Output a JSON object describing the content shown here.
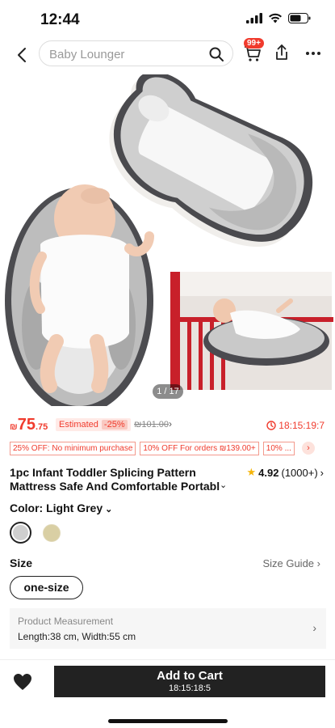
{
  "status": {
    "time": "12:44"
  },
  "header": {
    "search_placeholder": "Baby Lounger",
    "cart_badge": "99+",
    "icons": [
      "back-arrow-icon",
      "search-icon",
      "cart-icon",
      "share-icon",
      "more-icon"
    ]
  },
  "gallery": {
    "counter": "1 / 17"
  },
  "price": {
    "currency": "₪",
    "integer": "75",
    "decimal": ".75",
    "estimated_label": "Estimated",
    "discount": "-25%",
    "original": "₪101.00",
    "countdown": "18:15:19:7"
  },
  "coupons": [
    "25% OFF: No minimum purchase",
    "10% OFF For orders ₪139.00+",
    "10% ..."
  ],
  "product": {
    "title": "1pc Infant Toddler Splicing Pattern Mattress Safe And Comfortable Portabl",
    "rating": "4.92",
    "reviews": "(1000+)"
  },
  "color": {
    "label": "Color: Light Grey",
    "options": [
      "Light Grey",
      "Beige"
    ],
    "selected": "Light Grey"
  },
  "size": {
    "label": "Size",
    "guide": "Size Guide",
    "selected": "one-size"
  },
  "measurement": {
    "title": "Product Measurement",
    "length_label": "Length:",
    "length_value": "38 cm",
    "width_label": "Width:",
    "width_value": "55 cm"
  },
  "bottom": {
    "add_to_cart": "Add to Cart",
    "countdown": "18:15:18:5"
  },
  "colors": {
    "accent": "#f03b2d",
    "button": "#222222"
  }
}
